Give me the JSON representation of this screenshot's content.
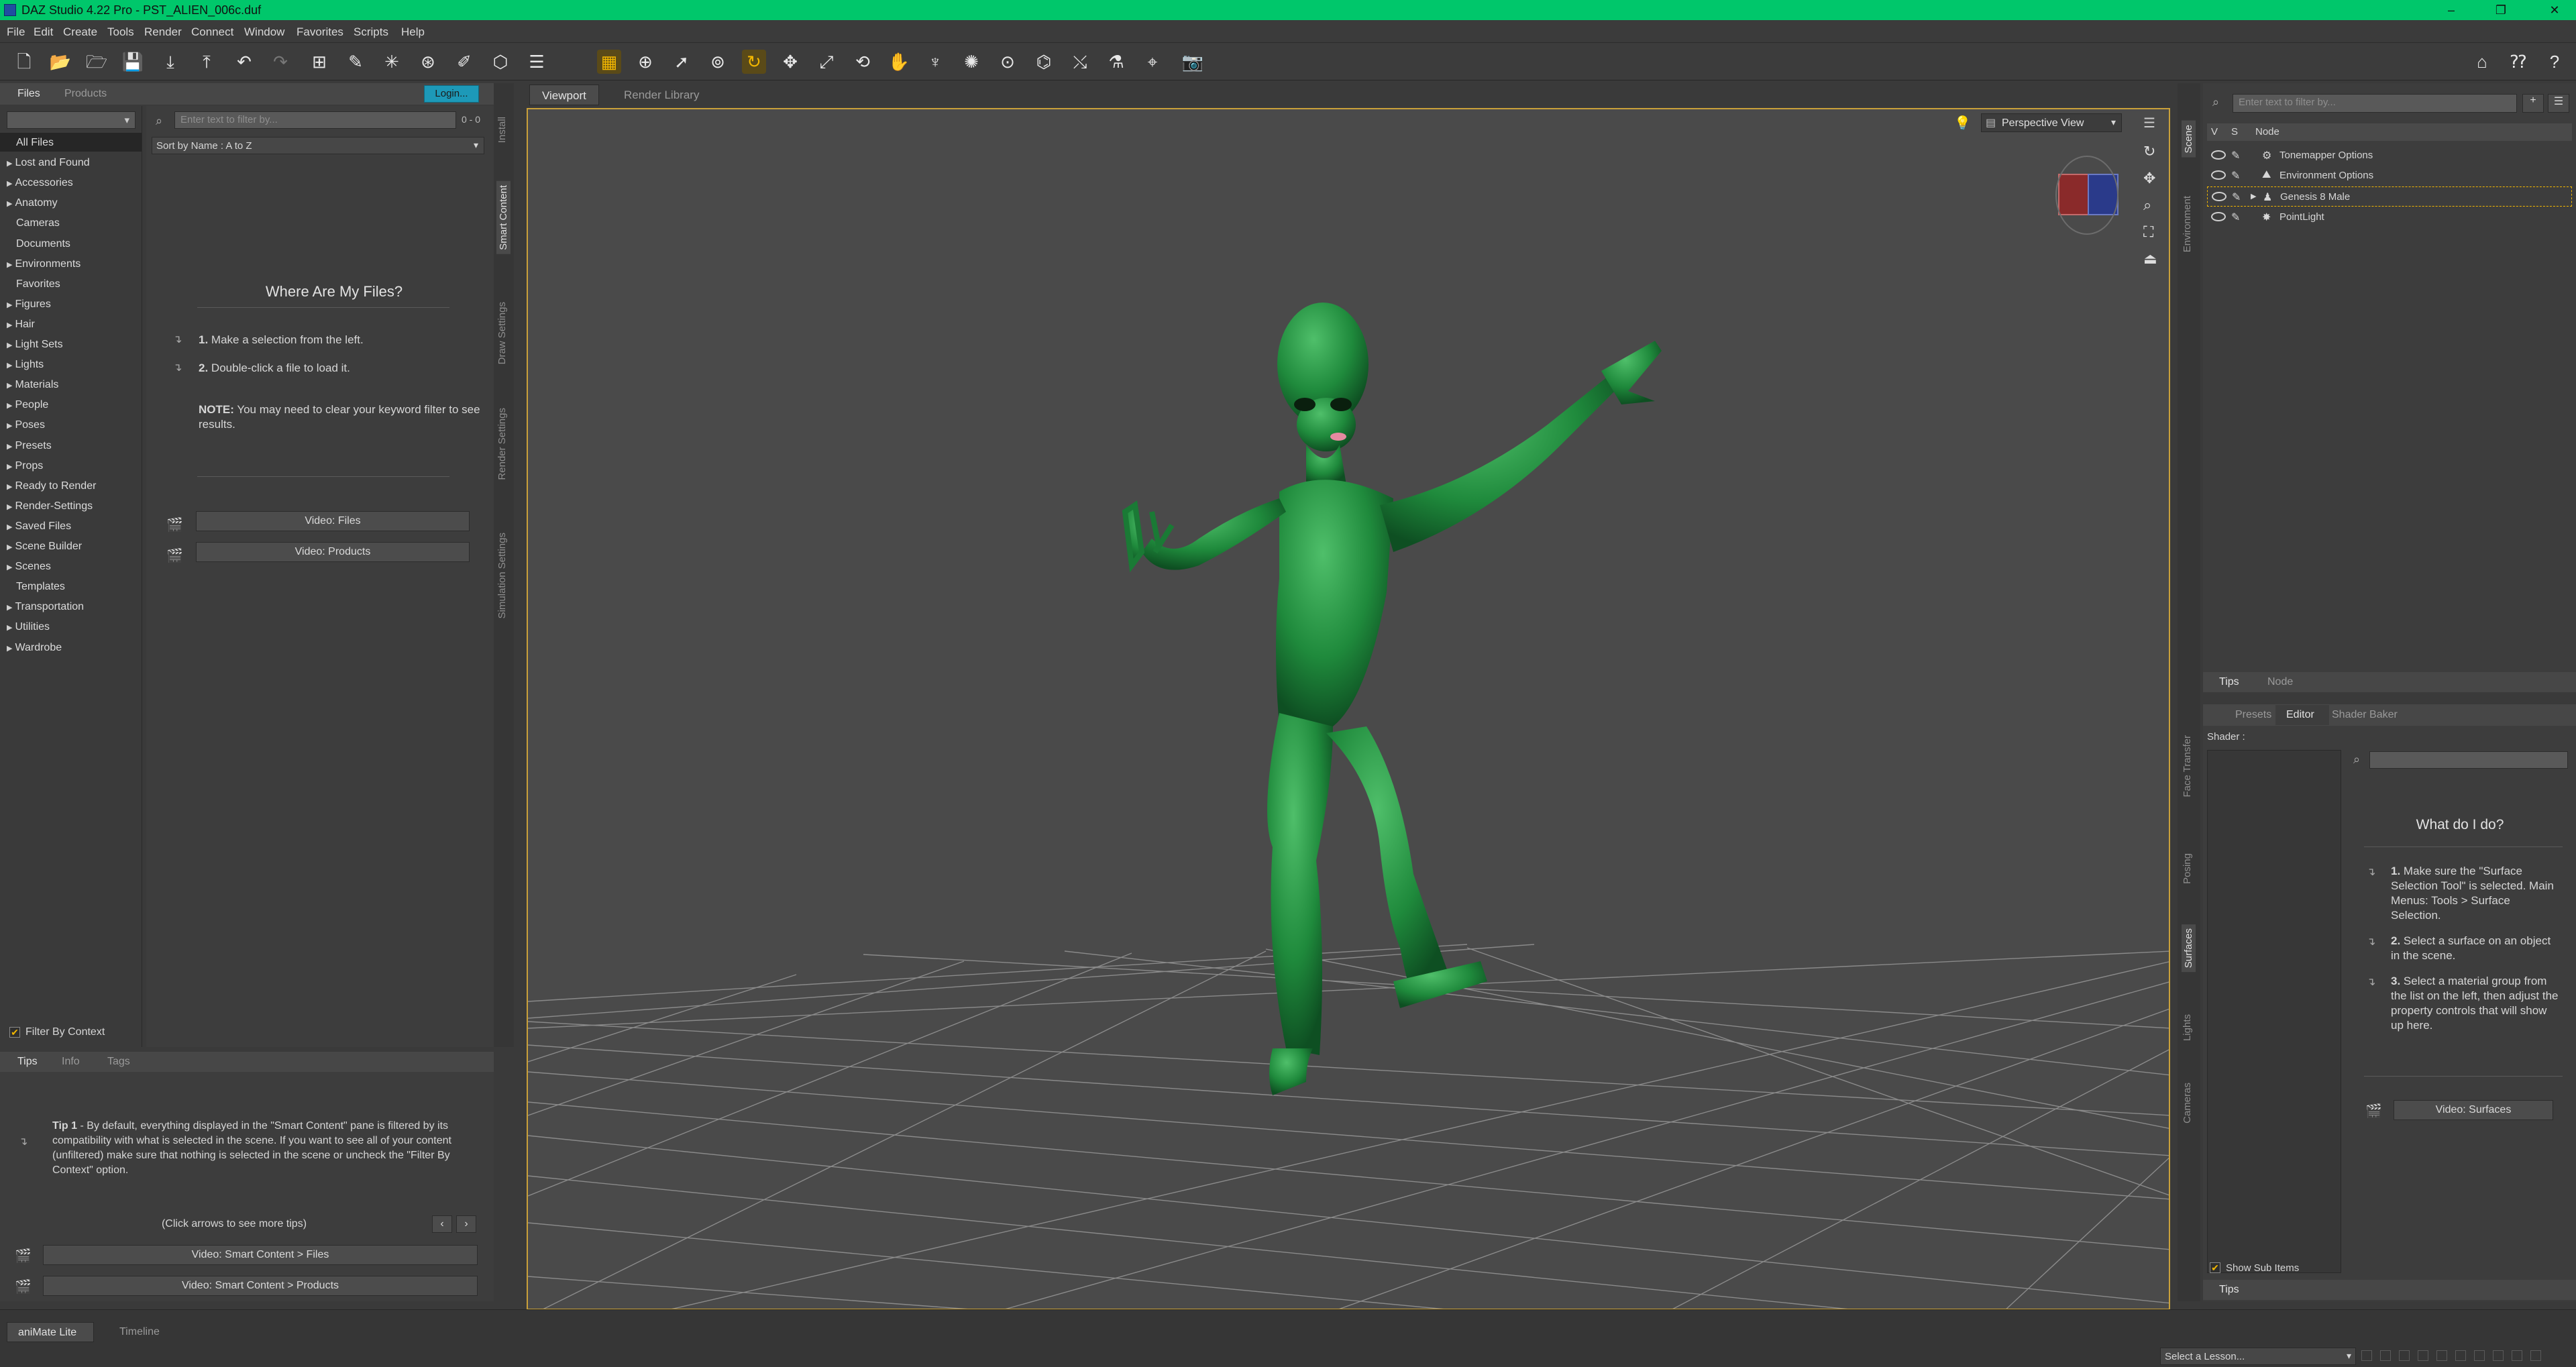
{
  "window": {
    "title": "DAZ Studio 4.22 Pro - PST_ALIEN_006c.duf",
    "controls": [
      "–",
      "❐",
      "✕"
    ]
  },
  "menu": [
    "File",
    "Edit",
    "Create",
    "Tools",
    "Render",
    "Connect",
    "Window",
    "Favorites",
    "Scripts",
    "Help"
  ],
  "toolbar": {
    "tools": [
      "new-file-icon",
      "open-file-icon",
      "open-folder-icon",
      "save-icon",
      "import-icon",
      "export-icon",
      "undo-icon",
      "redo-icon",
      "scene-icon",
      "select-joint-icon",
      "active-pose-icon",
      "node-weight-icon",
      "joint-editor-icon",
      "region-nav-icon",
      "surface-select-icon",
      "geometry-edit-icon",
      "move-gizmo-icon",
      "grid-toggle-icon",
      "universal-tool-icon",
      "node-select-icon",
      "rotate-icon",
      "translate-icon",
      "scale-icon",
      "transform-icon",
      "spot-render-icon",
      "pose-tool-icon",
      "morph-icon",
      "light-icon",
      "camera-icon",
      "pointer-icon",
      "geometry-brush-icon",
      "shader-icon",
      "render-icon"
    ],
    "right": [
      "home-icon",
      "help-whatsthis-icon",
      "help-icon"
    ]
  },
  "left_panel": {
    "tabs": [
      "Files",
      "Products"
    ],
    "login_label": "Login...",
    "filter_placeholder": "Enter text to filter by...",
    "count": "0 - 0",
    "sort_label": "Sort by Name : A to Z",
    "categories": [
      {
        "label": "All Files",
        "arrow": false,
        "selected": true
      },
      {
        "label": "Lost and Found",
        "arrow": true
      },
      {
        "label": "Accessories",
        "arrow": true
      },
      {
        "label": "Anatomy",
        "arrow": true
      },
      {
        "label": "Cameras",
        "arrow": false
      },
      {
        "label": "Documents",
        "arrow": false
      },
      {
        "label": "Environments",
        "arrow": true
      },
      {
        "label": "Favorites",
        "arrow": false
      },
      {
        "label": "Figures",
        "arrow": true
      },
      {
        "label": "Hair",
        "arrow": true
      },
      {
        "label": "Light Sets",
        "arrow": true
      },
      {
        "label": "Lights",
        "arrow": true
      },
      {
        "label": "Materials",
        "arrow": true
      },
      {
        "label": "People",
        "arrow": true
      },
      {
        "label": "Poses",
        "arrow": true
      },
      {
        "label": "Presets",
        "arrow": true
      },
      {
        "label": "Props",
        "arrow": true
      },
      {
        "label": "Ready to Render",
        "arrow": true
      },
      {
        "label": "Render-Settings",
        "arrow": true
      },
      {
        "label": "Saved Files",
        "arrow": true
      },
      {
        "label": "Scene Builder",
        "arrow": true
      },
      {
        "label": "Scenes",
        "arrow": true
      },
      {
        "label": "Templates",
        "arrow": false
      },
      {
        "label": "Transportation",
        "arrow": true
      },
      {
        "label": "Utilities",
        "arrow": true
      },
      {
        "label": "Wardrobe",
        "arrow": true
      }
    ],
    "filter_context_label": "Filter By Context",
    "help": {
      "title": "Where Are My Files?",
      "step1_num": "1.",
      "step1": "Make a selection from the left.",
      "step2_num": "2.",
      "step2": "Double-click a file to load it.",
      "note_label": "NOTE:",
      "note": "You may need to clear your keyword filter to see results.",
      "video_files": "Video: Files",
      "video_products": "Video:  Products"
    },
    "vertical_tabs": [
      "Install",
      "Smart Content",
      "Draw Settings",
      "Render Settings",
      "Simulation Settings"
    ],
    "tips_tabs": [
      "Tips",
      "Info",
      "Tags"
    ],
    "tip_label": "Tip 1",
    "tip_text": " - By default, everything displayed in the \"Smart Content\" pane is filtered by its compatibility with what is selected in the scene. If you want to see all of your content (unfiltered) make sure that nothing is selected in the scene or uncheck the \"Filter By Context\" option.",
    "tip_nav": "(Click arrows to see more tips)",
    "video_sc_files": "Video: Smart Content > Files",
    "video_sc_products": "Video: Smart Content > Products"
  },
  "viewport": {
    "tabs": [
      "Viewport",
      "Render Library"
    ],
    "view_label": "Perspective View"
  },
  "scene_panel": {
    "filter_placeholder": "Enter text to filter by...",
    "headers": [
      "V",
      "S",
      "Node"
    ],
    "nodes": [
      "Tonemapper Options",
      "Environment Options",
      "Genesis 8 Male",
      "PointLight"
    ],
    "vertical_tabs_top": [
      "Scene",
      "Environment"
    ],
    "bottom_tabs": [
      "Tips",
      "Node"
    ]
  },
  "surfaces_panel": {
    "tabs": [
      "Presets",
      "Editor",
      "Shader Baker"
    ],
    "shader_label": "Shader :",
    "help_title": "What do I do?",
    "step1_num": "1.",
    "step1": "Make sure the \"Surface Selection Tool\" is selected. Main Menus: Tools > Surface Selection.",
    "step2_num": "2.",
    "step2": "Select a surface on an object in the scene.",
    "step3_num": "3.",
    "step3": "Select a material group from the list on the left, then adjust the property controls that will show up here.",
    "video_label": "Video: Surfaces",
    "show_sub_items": "Show Sub Items",
    "tips_tab": "Tips",
    "vertical_tabs": [
      "Face Transfer",
      "Posing",
      "Surfaces",
      "Lights",
      "Cameras"
    ]
  },
  "bottom_bar": {
    "tabs": [
      "aniMate Lite",
      "Timeline"
    ],
    "lesson_placeholder": "Select a Lesson..."
  }
}
